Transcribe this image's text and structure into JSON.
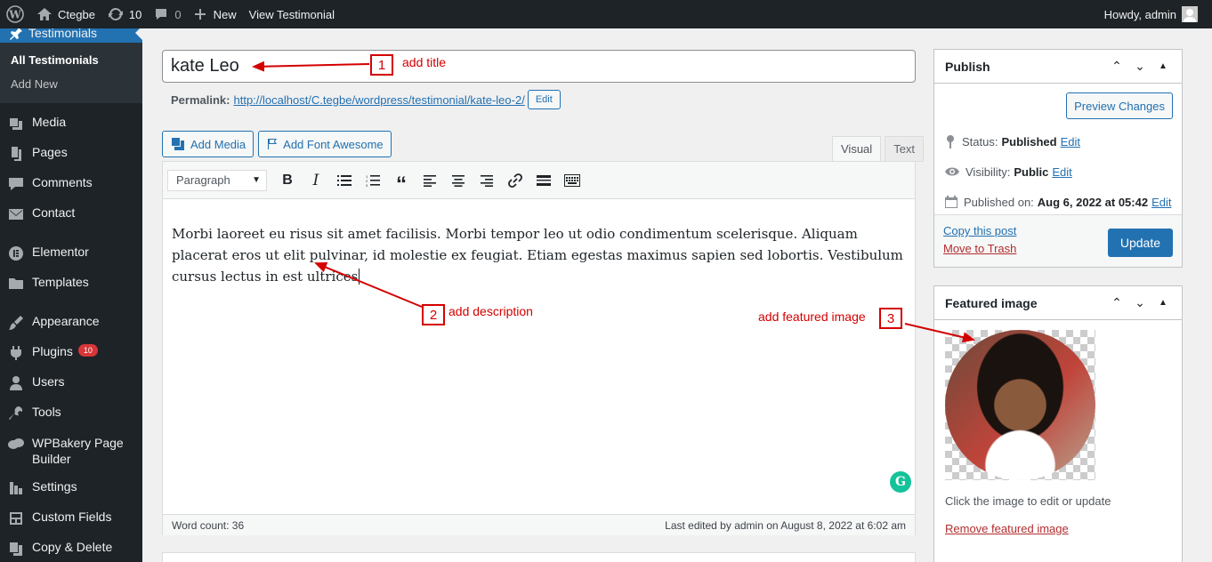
{
  "adminbar": {
    "site_name": "Ctegbe",
    "updates_count": "10",
    "comments_count": "0",
    "new_label": "New",
    "view_label": "View Testimonial",
    "howdy": "Howdy, admin"
  },
  "sidebar": {
    "current": "Testimonials",
    "submenu": [
      "All Testimonials",
      "Add New"
    ],
    "items": [
      {
        "label": "Media",
        "icon": "media-icon"
      },
      {
        "label": "Pages",
        "icon": "pages-icon"
      },
      {
        "label": "Comments",
        "icon": "comments-icon"
      },
      {
        "label": "Contact",
        "icon": "mail-icon"
      },
      {
        "label": "Elementor",
        "icon": "elementor-icon"
      },
      {
        "label": "Templates",
        "icon": "folder-icon"
      },
      {
        "label": "Appearance",
        "icon": "brush-icon"
      },
      {
        "label": "Plugins",
        "icon": "plugin-icon",
        "badge": "10"
      },
      {
        "label": "Users",
        "icon": "user-icon"
      },
      {
        "label": "Tools",
        "icon": "wrench-icon"
      },
      {
        "label": "WPBakery Page Builder",
        "icon": "wpbakery-icon"
      },
      {
        "label": "Settings",
        "icon": "settings-icon"
      },
      {
        "label": "Custom Fields",
        "icon": "custom-fields-icon"
      },
      {
        "label": "Copy & Delete",
        "icon": "copy-icon"
      }
    ]
  },
  "editor": {
    "title_value": "kate Leo",
    "permalink_label": "Permalink:",
    "permalink_url": "http://localhost/C.tegbe/wordpress/testimonial/kate-leo-2/",
    "edit_label": "Edit",
    "add_media": "Add Media",
    "add_font_awesome": "Add Font Awesome",
    "tab_visual": "Visual",
    "tab_text": "Text",
    "format": "Paragraph",
    "content": "Morbi laoreet eu risus sit amet facilisis. Morbi tempor leo ut odio condimentum scelerisque. Aliquam placerat eros ut elit pulvinar, id molestie ex feugiat. Etiam egestas maximus sapien sed lobortis. Vestibulum cursus lectus in est ultrices",
    "word_count": "Word count: 36",
    "last_edited": "Last edited by admin on August 8, 2022 at 6:02 am"
  },
  "publish": {
    "title": "Publish",
    "preview": "Preview Changes",
    "status_label": "Status:",
    "status_value": "Published",
    "visibility_label": "Visibility:",
    "visibility_value": "Public",
    "published_label": "Published on:",
    "published_value": "Aug 6, 2022 at 05:42",
    "edit": "Edit",
    "copy_post": "Copy this post",
    "trash": "Move to Trash",
    "update": "Update"
  },
  "featured": {
    "title": "Featured image",
    "hint": "Click the image to edit or update",
    "remove": "Remove featured image"
  },
  "annotations": [
    {
      "num": "1",
      "text": "add title"
    },
    {
      "num": "2",
      "text": "add description"
    },
    {
      "num": "3",
      "text": "add featured image"
    }
  ],
  "colors": {
    "accent": "#2271b1",
    "admin_dark": "#1d2327",
    "annotation": "#d40000"
  }
}
